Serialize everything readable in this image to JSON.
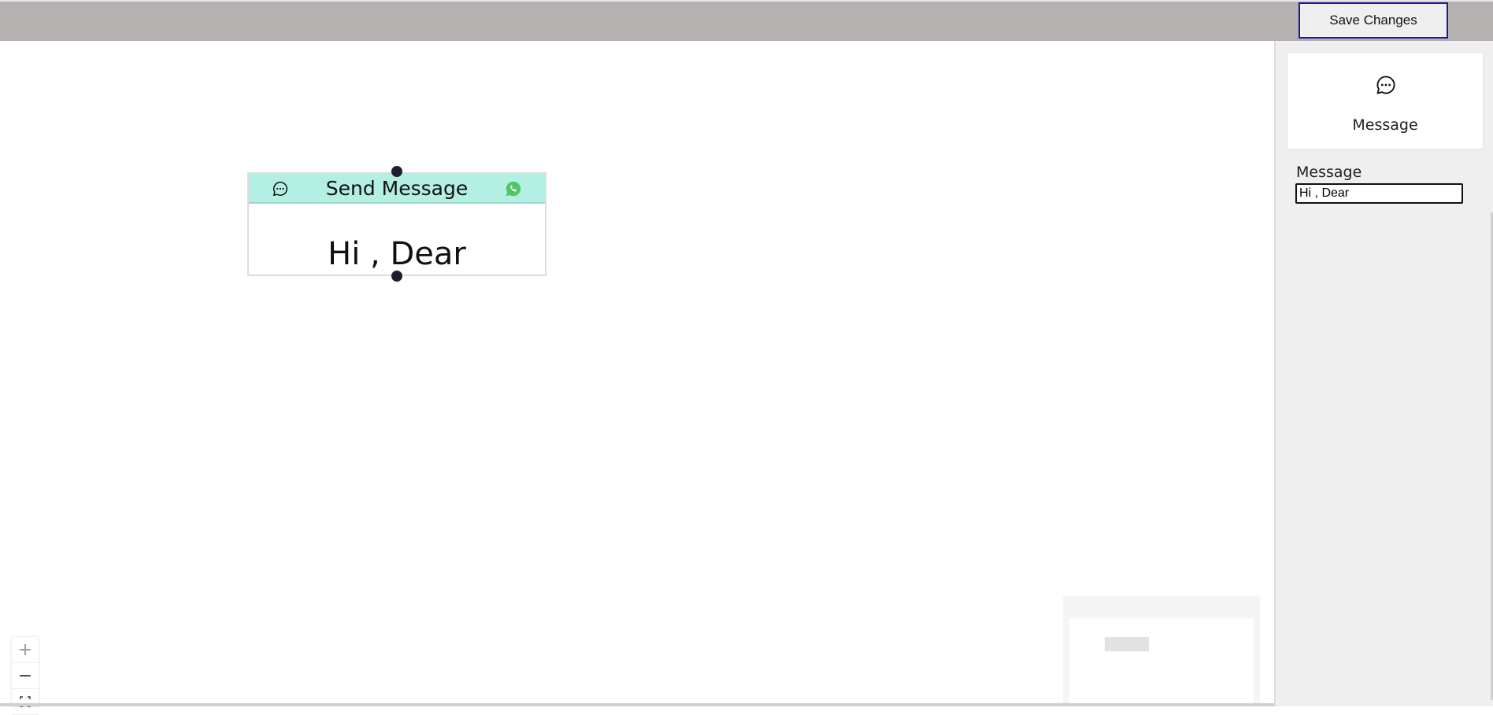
{
  "toolbar": {
    "save_label": "Save Changes"
  },
  "node": {
    "title": "Send Message",
    "body": "Hi , Dear",
    "left_icon": "message-bubble-icon",
    "right_icon": "whatsapp-icon",
    "header_color": "#b3efe2"
  },
  "canvas_controls": {
    "zoom_in": "+",
    "zoom_out": "−"
  },
  "sidebar": {
    "card": {
      "label": "Message",
      "icon": "message-bubble-icon"
    },
    "field": {
      "label": "Message",
      "value": "Hi , Dear"
    }
  },
  "colors": {
    "topbar": "#b5b1b0",
    "save_border": "#1a1aa8",
    "whatsapp_green": "#52c567",
    "handle": "#1e1e2e"
  }
}
